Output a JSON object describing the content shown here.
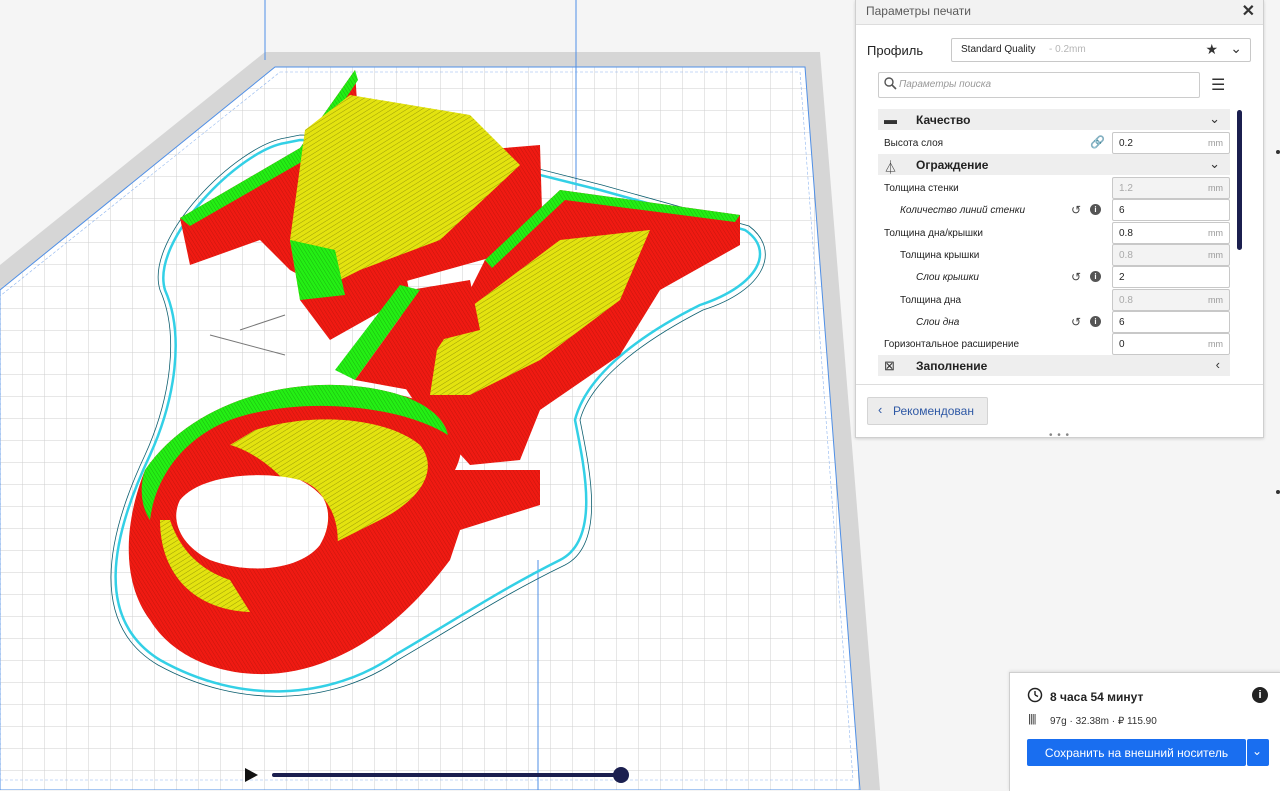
{
  "settings_panel": {
    "title": "Параметры печати",
    "profile": {
      "label": "Профиль",
      "name": "Standard Quality",
      "layer_height_hint": "- 0.2mm"
    },
    "search": {
      "placeholder": "Параметры поиска"
    },
    "categories": {
      "quality": "Качество",
      "shell": "Ограждение",
      "infill": "Заполнение"
    },
    "settings": [
      {
        "label": "Высота слоя",
        "value": "0.2",
        "unit": "mm"
      },
      {
        "label": "Толщина стенки",
        "value": "1.2",
        "unit": "mm"
      },
      {
        "label": "Количество линий стенки",
        "value": "6",
        "unit": ""
      },
      {
        "label": "Толщина дна/крышки",
        "value": "0.8",
        "unit": "mm"
      },
      {
        "label": "Толщина крышки",
        "value": "0.8",
        "unit": "mm"
      },
      {
        "label": "Слои крышки",
        "value": "2",
        "unit": ""
      },
      {
        "label": "Толщина дна",
        "value": "0.8",
        "unit": "mm"
      },
      {
        "label": "Слои дна",
        "value": "6",
        "unit": ""
      },
      {
        "label": "Горизонтальное расширение",
        "value": "0",
        "unit": "mm"
      }
    ],
    "recommended_label": "Рекомендован"
  },
  "output_panel": {
    "print_time": "8 часа 54 минут",
    "material_info": "97g · 32.38m · ₽ 115.90",
    "save_label": "Сохранить на внешний носитель"
  },
  "colors": {
    "wall_outer": "#f21b12",
    "wall_inner": "#21ee12",
    "top_bottom": "#e6e60d",
    "skirt": "#33d0e6",
    "accent": "#196ef0",
    "scrollbar": "#1b1f4f"
  },
  "icons": {
    "close": "close-icon",
    "favorite": "star-icon",
    "search": "search-icon",
    "menu": "menu-icon",
    "time": "clock-icon",
    "material": "spool-icon",
    "info": "info-circle-icon"
  }
}
